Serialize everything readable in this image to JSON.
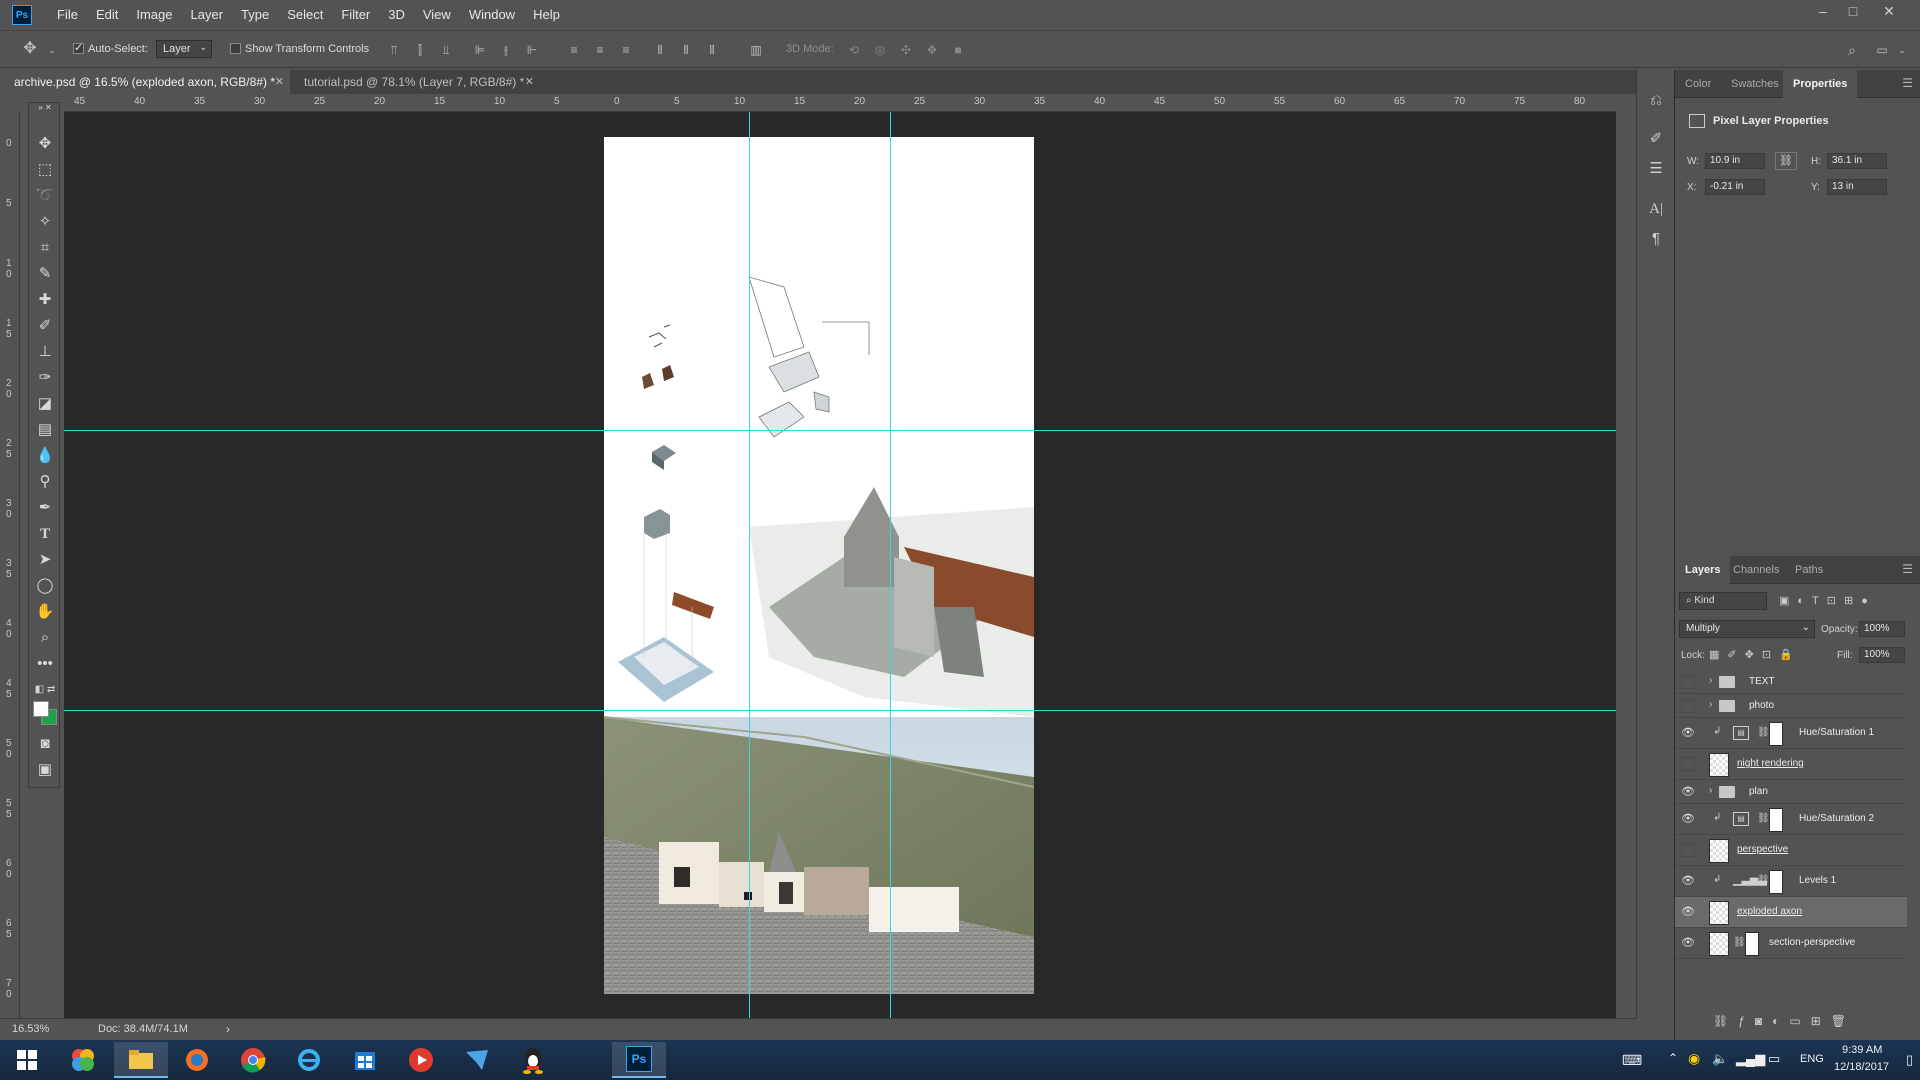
{
  "menu": [
    "File",
    "Edit",
    "Image",
    "Layer",
    "Type",
    "Select",
    "Filter",
    "3D",
    "View",
    "Window",
    "Help"
  ],
  "app_logo": "Ps",
  "options": {
    "auto_select_label": "Auto-Select:",
    "auto_select_checked": true,
    "auto_select_value": "Layer",
    "transform_label": "Show Transform Controls",
    "transform_checked": false,
    "mode_3d_label": "3D Mode:"
  },
  "tabs": [
    {
      "label": "archive.psd @ 16.5% (exploded axon, RGB/8#) *",
      "active": true
    },
    {
      "label": "tutorial.psd @ 78.1% (Layer 7, RGB/8#) *",
      "active": false
    }
  ],
  "ruler_top": [
    "45",
    "40",
    "35",
    "30",
    "25",
    "20",
    "15",
    "10",
    "5",
    "0",
    "5",
    "10",
    "15",
    "20",
    "25",
    "30",
    "35",
    "40",
    "45",
    "50",
    "55",
    "60",
    "65",
    "70",
    "75",
    "80"
  ],
  "ruler_left": [
    "0",
    "5",
    "10",
    "15",
    "20",
    "25",
    "30",
    "35",
    "40",
    "45",
    "50",
    "55",
    "60",
    "65",
    "70"
  ],
  "status": {
    "zoom": "16.53%",
    "doc": "Doc: 38.4M/74.1M"
  },
  "right_panel": {
    "tabs": [
      "Color",
      "Swatches",
      "Properties"
    ],
    "active_tab": "Properties",
    "props_title": "Pixel Layer Properties",
    "w_label": "W:",
    "w_value": "10.9 in",
    "h_label": "H:",
    "h_value": "36.1 in",
    "x_label": "X:",
    "x_value": "-0.21 in",
    "y_label": "Y:",
    "y_value": "13 in"
  },
  "layers_panel": {
    "tabs": [
      "Layers",
      "Channels",
      "Paths"
    ],
    "active_tab": "Layers",
    "filter_label": "Kind",
    "blend_mode": "Multiply",
    "opacity_label": "Opacity:",
    "opacity_value": "100%",
    "lock_label": "Lock:",
    "fill_label": "Fill:",
    "fill_value": "100%",
    "layers": [
      {
        "name": "TEXT",
        "kind": "group",
        "visible": false
      },
      {
        "name": "photo",
        "kind": "group",
        "visible": false
      },
      {
        "name": "Hue/Saturation 1",
        "kind": "adjustment",
        "visible": true,
        "adj_icon": "hue-sat"
      },
      {
        "name": "night rendering",
        "kind": "pixel",
        "visible": false
      },
      {
        "name": "plan",
        "kind": "group",
        "visible": true
      },
      {
        "name": "Hue/Saturation 2",
        "kind": "adjustment",
        "visible": true,
        "adj_icon": "hue-sat"
      },
      {
        "name": "perspective",
        "kind": "pixel",
        "visible": false
      },
      {
        "name": "Levels 1",
        "kind": "adjustment",
        "visible": true,
        "adj_icon": "levels"
      },
      {
        "name": "exploded axon",
        "kind": "pixel",
        "visible": true,
        "selected": true
      },
      {
        "name": "section-perspective",
        "kind": "pixel-mask",
        "visible": true
      }
    ]
  },
  "taskbar": {
    "apps": [
      "windows-start",
      "photos-icon",
      "file-explorer",
      "media-icon",
      "chrome",
      "internet-explorer",
      "store-icon",
      "media-player",
      "mail-icon",
      "qq-icon",
      "photoshop"
    ],
    "tray_lang": "ENG",
    "time": "9:39 AM",
    "date": "12/18/2017"
  }
}
